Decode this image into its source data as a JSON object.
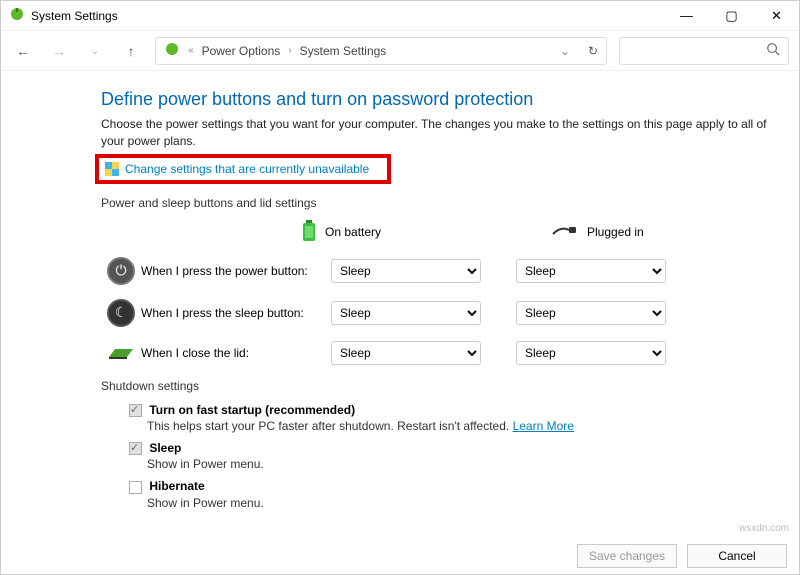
{
  "window": {
    "title": "System Settings"
  },
  "breadcrumb": {
    "part1": "Power Options",
    "part2": "System Settings"
  },
  "heading": "Define power buttons and turn on password protection",
  "description": "Choose the power settings that you want for your computer. The changes you make to the settings on this page apply to all of your power plans.",
  "change_link": "Change settings that are currently unavailable",
  "section1_title": "Power and sleep buttons and lid settings",
  "cols": {
    "battery": "On battery",
    "plugged": "Plugged in"
  },
  "rows": {
    "power": {
      "label": "When I press the power button:",
      "battery": "Sleep",
      "plugged": "Sleep"
    },
    "sleep": {
      "label": "When I press the sleep button:",
      "battery": "Sleep",
      "plugged": "Sleep"
    },
    "lid": {
      "label": "When I close the lid:",
      "battery": "Sleep",
      "plugged": "Sleep"
    }
  },
  "section2_title": "Shutdown settings",
  "shutdown": {
    "fast": {
      "label": "Turn on fast startup (recommended)",
      "sub": "This helps start your PC faster after shutdown. Restart isn't affected.",
      "learn": "Learn More"
    },
    "sleep": {
      "label": "Sleep",
      "sub": "Show in Power menu."
    },
    "hibernate": {
      "label": "Hibernate",
      "sub": "Show in Power menu."
    }
  },
  "footer": {
    "save": "Save changes",
    "cancel": "Cancel"
  },
  "watermark": "wsxdn.com"
}
